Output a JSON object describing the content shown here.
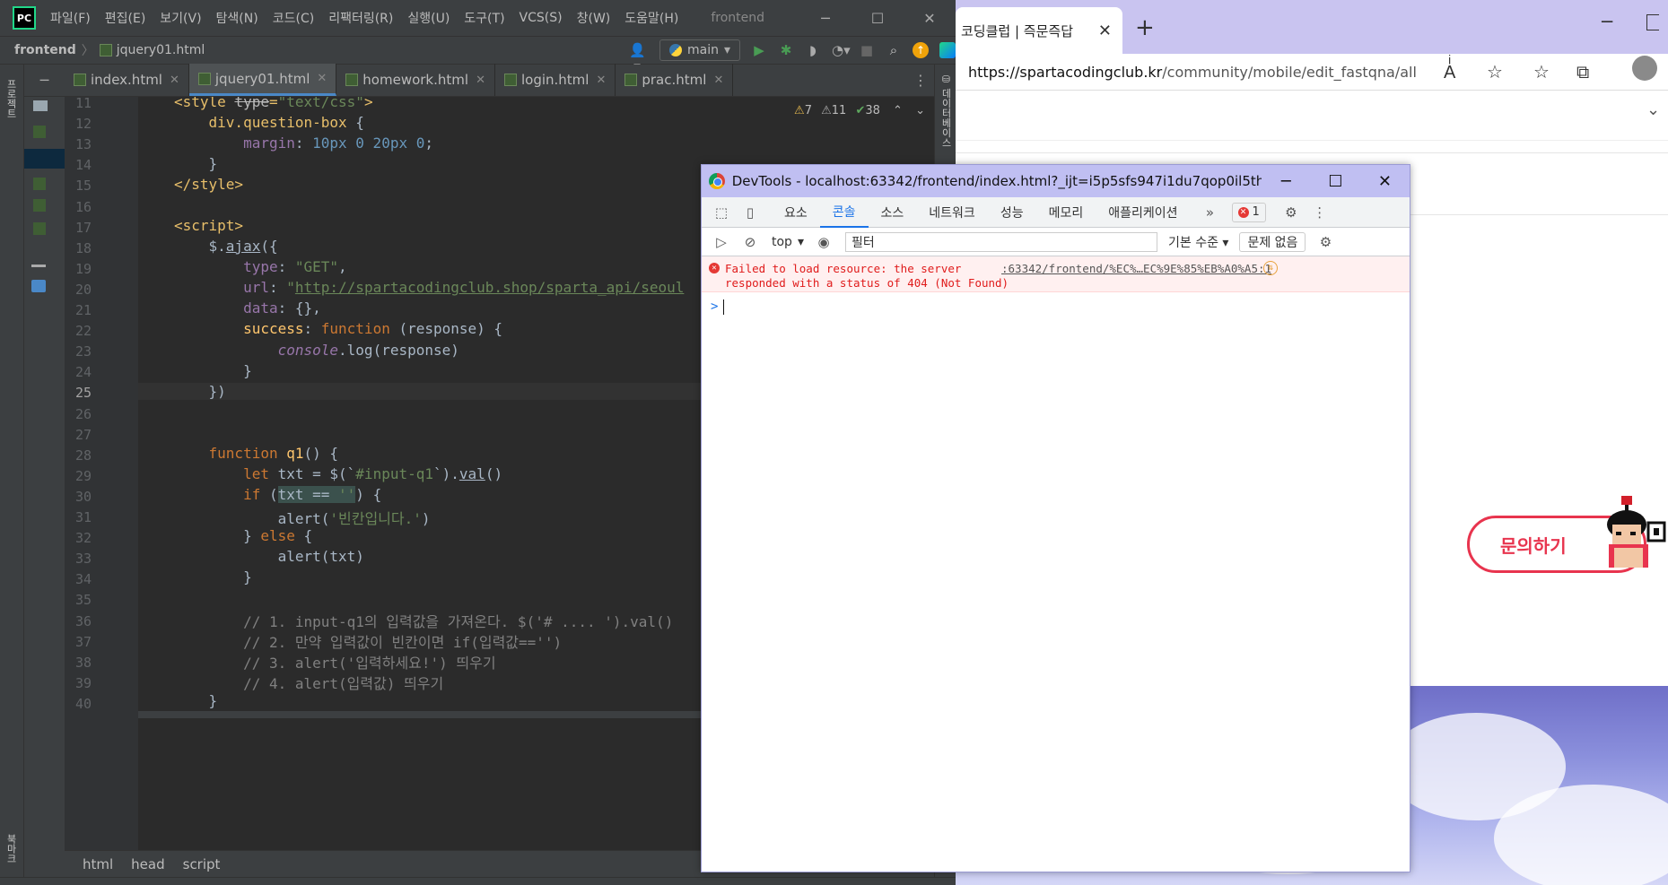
{
  "ide": {
    "logo_text": "PC",
    "menu": [
      "파일(F)",
      "편집(E)",
      "보기(V)",
      "탐색(N)",
      "코드(C)",
      "리팩터링(R)",
      "실행(U)",
      "도구(T)",
      "VCS(S)",
      "창(W)",
      "도움말(H)"
    ],
    "window_title": "frontend",
    "project": "frontend",
    "current_file": "jquery01.html",
    "run_config": "main",
    "tabs": [
      "index.html",
      "jquery01.html",
      "homework.html",
      "login.html",
      "prac.html"
    ],
    "active_tab": "jquery01.html",
    "left_strip_labels": [
      "프로젝트",
      "북마크",
      "구조"
    ],
    "right_strip_label": "데이터베이스",
    "inspections": {
      "warnings": "7",
      "weak_warnings": "11",
      "typos": "38"
    },
    "line_numbers": [
      "11",
      "12",
      "13",
      "14",
      "15",
      "16",
      "17",
      "18",
      "19",
      "20",
      "21",
      "22",
      "23",
      "24",
      "25",
      "26",
      "27",
      "28",
      "29",
      "30",
      "31",
      "32",
      "33",
      "34",
      "35",
      "36",
      "37",
      "38",
      "39",
      "40"
    ],
    "breadcrumb": [
      "html",
      "head",
      "script"
    ]
  },
  "browser": {
    "tab_title": "코딩클럽 | 즉문즉답",
    "url_host": "https://spartacodingclub.kr",
    "url_path": "/community/mobile/edit_fastqna/all",
    "ask_button": "문의하기"
  },
  "devtools": {
    "title": "DevTools - localhost:63342/frontend/index.html?_ijt=i5p5sfs947i1du7qop0il5thqv&_ij...",
    "tabs": [
      "요소",
      "콘솔",
      "소스",
      "네트워크",
      "성능",
      "메모리",
      "애플리케이션"
    ],
    "active_tab": "콘솔",
    "error_count": "1",
    "context": "top",
    "filter_placeholder": "필터",
    "level": "기본 수준",
    "issues": "문제 없음",
    "error_message": "Failed to load resource: the server\nresponded with a status of 404 (Not Found)",
    "error_source": ":63342/frontend/%EC%…EC%9E%85%EB%A0%A5:1",
    "prompt": ">"
  },
  "colors": {
    "ide_bg": "#2b2b2b",
    "accent": "#1a73e8",
    "error": "#e01b1b",
    "ask": "#e8344e"
  }
}
